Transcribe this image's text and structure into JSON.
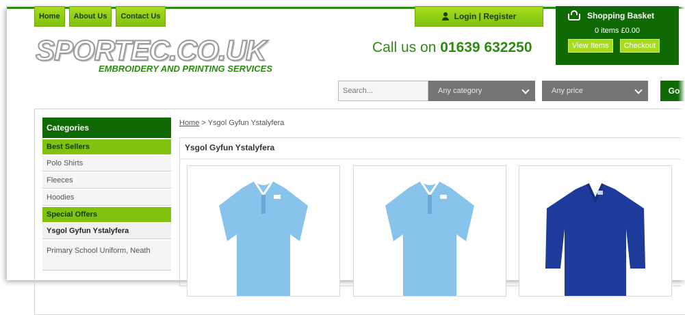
{
  "nav": {
    "home": "Home",
    "about": "About Us",
    "contact": "Contact Us"
  },
  "login": {
    "label": "Login | Register"
  },
  "basket": {
    "title": "Shopping Basket",
    "count": "0 items £0.00",
    "view": "View Items",
    "checkout": "Checkout"
  },
  "brand": {
    "logo": "SPORTEC.CO.UK",
    "tagline": "EMBROIDERY AND PRINTING SERVICES"
  },
  "phone": {
    "prefix": "Call us on ",
    "number": "01639 632250"
  },
  "search": {
    "placeholder": "Search...",
    "category": "Any category",
    "price": "Any price",
    "go": "Go"
  },
  "sidebar": {
    "heading": "Categories",
    "best_sellers": "Best Sellers",
    "items": [
      "Polo Shirts",
      "Fleeces",
      "Hoodies"
    ],
    "special_offers": "Special Offers",
    "offers": [
      "Ysgol Gyfun Ystalyfera",
      "Primary School Uniform, Neath"
    ]
  },
  "breadcrumb": {
    "home": "Home",
    "sep": " > ",
    "current": "Ysgol Gyfun Ystalyfera"
  },
  "main": {
    "title": "Ysgol Gyfun Ystalyfera"
  },
  "products": [
    {
      "color": "#87c3ea",
      "type": "polo"
    },
    {
      "color": "#87c3ea",
      "type": "polo"
    },
    {
      "color": "#1e3a9a",
      "type": "vneck"
    }
  ]
}
